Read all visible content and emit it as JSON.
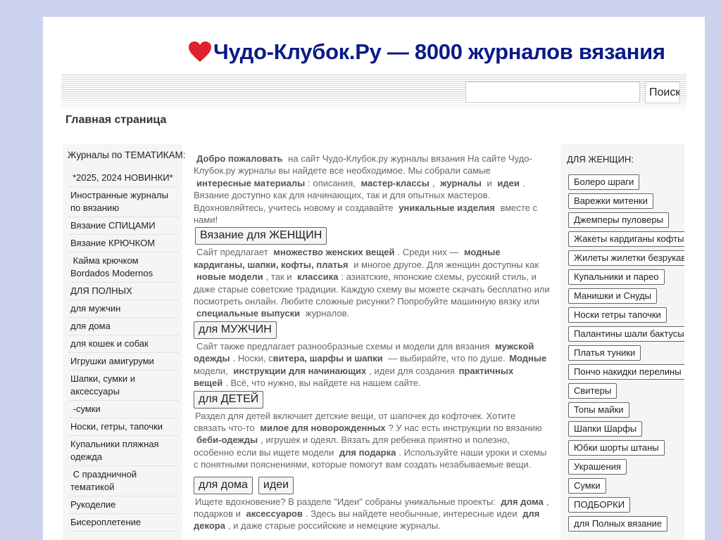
{
  "header": {
    "title": "Чудо-Клубок.Ру — 8000 журналов вязания",
    "heart_color": "#e0222e",
    "title_color": "#0b1a86"
  },
  "search": {
    "value": "",
    "placeholder": "",
    "button_label": "Поиск"
  },
  "breadcrumb": "Главная страница",
  "left_sidebar": {
    "title": "Журналы по ТЕМАТИКАМ:",
    "items": [
      "*2025, 2024 НОВИНКИ*",
      "Иностранные журналы по вязанию",
      "Вязание СПИЦАМИ",
      "Вязание КРЮЧКОМ",
      " Кайма крючком Bordados Modernos",
      "ДЛЯ ПОЛНЫХ",
      "для мужчин",
      "для дома",
      "для кошек и собак",
      "Игрушки амигуруми",
      "Шапки, сумки и аксессуары",
      " -сумки",
      "Носки, гетры, тапочки",
      "Купальники пляжная одежда",
      " С праздничной тематикой",
      "Рукоделие",
      "Бисероплетение"
    ]
  },
  "content": {
    "p1": [
      "Добро пожаловать",
      " на сайт Чудо-Клубок.ру журналы вязания  На сайте Чудо-Клубок.ру журналы вы найдете все необходимое. Мы собрали самые ",
      "интересные материалы",
      ": описания, ",
      "мастер-классы",
      ", ",
      "журналы",
      " и ",
      "идеи",
      ". Вязание доступно как для начинающих, так и для опытных мастеров. Вдохновляйтесь, учитесь новому и создавайте ",
      "уникальные изделия",
      " вместе с нами!"
    ],
    "btn_women": "Вязание для ЖЕНЩИН",
    "p2": [
      "Сайт предлагает ",
      "множество женских вещей",
      ". Среди них — ",
      "модные кардиганы, шапки, кофты, платья",
      " и многое другое. Для женщин доступны как ",
      "новые модели",
      ", так и ",
      "классика",
      ": азиатские, японские схемы, русский стиль, и даже старые советские традиции. Каждую схему вы можете скачать бесплатно или посмотреть онлайн. Любите сложные рисунки? Попробуйте машинную вязку или ",
      "специальные выпуски",
      " журналов."
    ],
    "btn_men": "для МУЖЧИН",
    "p3": [
      "Сайт также предлагает разнообразные схемы и модели для вязания ",
      "мужской одежды",
      ". Носки, с",
      "витера, шарфы и шапки",
      " — выбирайте, что по душе. ",
      "Модные",
      " модели, ",
      "инструкции для начинающих",
      ", идеи для создания ",
      "практичных вещей",
      ". Всё, что нужно, вы найдете на нашем сайте."
    ],
    "btn_kids": "для ДЕТЕЙ",
    "p4": [
      "Раздел для детей включает детские вещи, от шапочек до кофточек. Хотите связать что-то ",
      "милое для новорожденных",
      "? У нас есть инструкции по вязанию ",
      "беби-одежды",
      ", игрушек и одеял. Вязать для ребенка приятно и полезно, особенно если вы ищете модели ",
      "для подарка",
      ". Используйте наши уроки и схемы с понятными пояснениями, которые помогут вам создать незабываемые вещи."
    ],
    "btn_home": "для дома",
    "btn_ideas": "идеи",
    "p5": [
      "Ищете вдохновение? В разделе \"Идеи\" собраны уникальные проекты: ",
      "для дома",
      ", подарков и ",
      "аксессуаров",
      ". Здесь вы найдете необычные, интересные идеи ",
      "для декора",
      ", и даже старые российские и немецкие журналы."
    ]
  },
  "right_sidebar": {
    "title": "ДЛЯ ЖЕНЩИН:",
    "items": [
      "Болеро шраги",
      "Варежки митенки",
      "Джемперы пуловеры",
      "Жакеты кардиганы кофты на пуговицах",
      "Жилеты жилетки безрукавки",
      "Купальники и парео",
      "Манишки и Снуды",
      "Носки гетры тапочки",
      "Палантины шали бактусы",
      "Платья туники",
      "Пончо накидки перелины",
      "Свитеры",
      "Топы майки",
      "Шапки Шарфы",
      "Юбки шорты штаны",
      "Украшения",
      "Сумки",
      "ПОДБОРКИ",
      "для Полных вязание"
    ]
  }
}
